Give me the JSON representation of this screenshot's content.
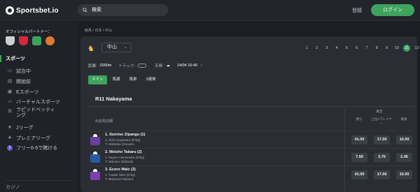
{
  "header": {
    "logo_text": "Sportsbet.io",
    "search_placeholder": "検索",
    "login_link": "登録",
    "login_button": "ログイン"
  },
  "sidebar": {
    "partner_title": "オフィシャルパートナー：",
    "partners": [
      {
        "name": "newcastle-crest-icon",
        "color": "#cfcfcf"
      },
      {
        "name": "southampton-crest-icon",
        "color": "#d7263d"
      },
      {
        "name": "partner-green-icon",
        "color": "#3da35d"
      },
      {
        "name": "basketball-icon",
        "color": "#e07a2f"
      }
    ],
    "sports_header": "スポーツ",
    "items": [
      {
        "label": "試合中",
        "icon": "monitor-icon"
      },
      {
        "label": "開始前",
        "icon": "calendar-icon"
      },
      {
        "label": "Eスポーツ",
        "icon": "controller-icon"
      },
      {
        "label": "バーチャルスポーツ",
        "icon": "virtual-icon"
      },
      {
        "label": "ラピッドベッティング",
        "icon": "rapid-icon"
      },
      {
        "label": "Jリーグ",
        "icon": "star-icon"
      },
      {
        "label": "プレミアリーグ",
        "icon": "star-icon"
      },
      {
        "label": "フリー6-6で賭ける",
        "icon": "six-icon"
      }
    ],
    "casino": "カジノ"
  },
  "main": {
    "breadcrumb": "競馬 • 日本 • 中山",
    "venue": "中山",
    "race_numbers": [
      "1",
      "2",
      "3",
      "4",
      "5",
      "6",
      "7",
      "8",
      "9",
      "10",
      "11",
      "12"
    ],
    "active_race": "11",
    "info": {
      "distance_label": "距離:",
      "distance_value": "2000m",
      "track_label": "トラック:",
      "weather_label": "天候:",
      "datetime": "14/04 15:40"
    },
    "tabs": [
      "メイン",
      "馬連",
      "馬単",
      "3連単"
    ],
    "active_tab": "メイン",
    "race_title": "R11 Nakayama",
    "table": {
      "runner_header": "出走馬詳細",
      "fixed_label": "確定",
      "odds_headers": [
        "勝ち",
        "上位2プレイヤー",
        "最後"
      ],
      "runners": [
        {
          "name": "1. Sunrise Zipangu (1)",
          "jockey": "J: Akira Sugawara (57kg)",
          "trainer": "T: Hidetaka Otonashi",
          "odds": [
            "41.00",
            "17.00",
            "10.00"
          ],
          "silk_color": "#6b3fa0"
        },
        {
          "name": "2. Meisho Tabaru (2)",
          "jockey": "J: Suguru Hamanaka (57kg)",
          "trainer": "T: Mamoru Ishibashi",
          "odds": [
            "7.50",
            "3.70",
            "2.45"
          ],
          "silk_color": "#2b57a8"
        },
        {
          "name": "3. Ecoro Walz (3)",
          "jockey": "J: Yutaka Take (57kg)",
          "trainer": "T: Mitsunori Makiura",
          "odds": [
            "41.00",
            "17.00",
            "10.00"
          ],
          "silk_color": "#7c3fb0"
        }
      ]
    }
  }
}
